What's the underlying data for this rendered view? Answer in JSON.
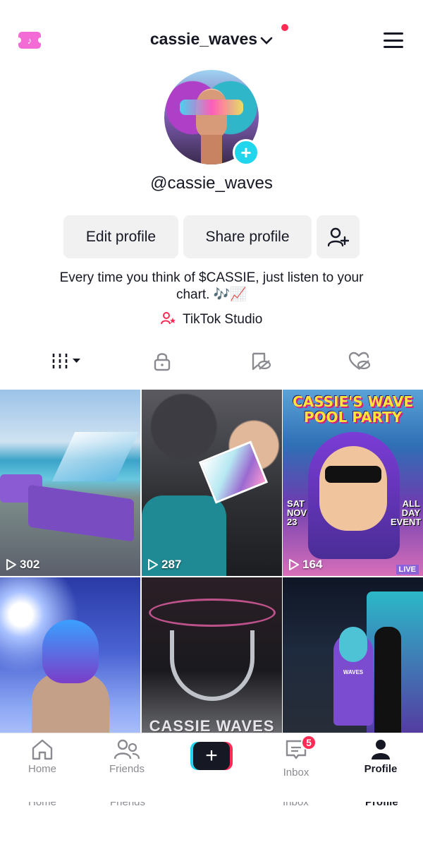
{
  "header": {
    "username": "cassie_waves",
    "icons": {
      "left": "tiktok-ticket-icon",
      "menu": "hamburger-menu-icon",
      "dropdown": "chevron-down-icon"
    },
    "notification_dot_color": "#fe2c55"
  },
  "profile": {
    "handle": "@cassie_waves",
    "avatar_badge": "+",
    "bio": "Every time you think of $CASSIE, just listen to your chart. 🎶📈",
    "studio_link": "TikTok Studio"
  },
  "actions": {
    "edit_profile": "Edit profile",
    "share_profile": "Share profile",
    "add_friend_icon": "add-friend-icon"
  },
  "tabs": [
    {
      "name": "videos",
      "icon": "grid-icon",
      "active": true
    },
    {
      "name": "private",
      "icon": "lock-icon"
    },
    {
      "name": "favorites",
      "icon": "bookmark-hidden-icon"
    },
    {
      "name": "liked",
      "icon": "heart-hidden-icon"
    }
  ],
  "videos": [
    {
      "views": "302"
    },
    {
      "views": "287"
    },
    {
      "views": "164",
      "poster": {
        "title": "CASSIE'S WAVE POOL PARTY",
        "left": "SAT NOV 23",
        "right": "ALL DAY EVENT",
        "badge": "LIVE"
      }
    },
    {
      "views": ""
    },
    {
      "views": "",
      "overlay": "CASSIE WAVES"
    },
    {
      "views": "",
      "jacket_text": "WAVES"
    }
  ],
  "bottom_nav": {
    "home": "Home",
    "friends": "Friends",
    "create": "+",
    "inbox": "Inbox",
    "inbox_badge": "5",
    "profile": "Profile"
  },
  "colors": {
    "accent": "#fe2c55",
    "teal": "#20d5ec",
    "text": "#161823",
    "muted": "#8a8b91",
    "button_bg": "#f1f1f2"
  }
}
